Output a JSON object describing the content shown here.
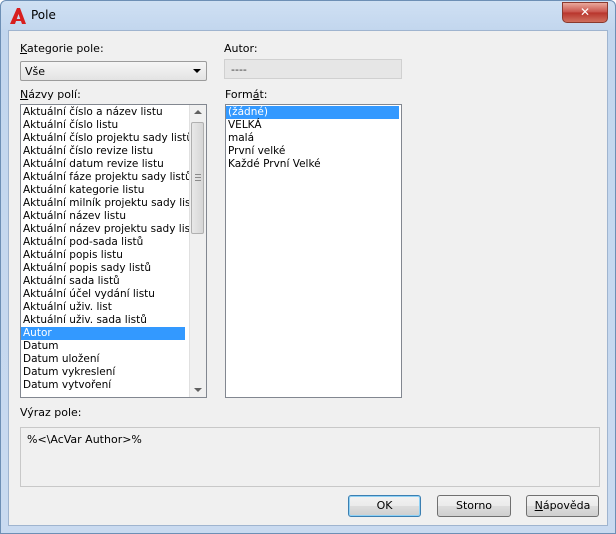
{
  "window": {
    "title": "Pole",
    "close_glyph": "✕"
  },
  "category": {
    "label": "Kategorie pole:",
    "label_accel": "K",
    "label_rest": "ategorie pole:",
    "value": "Vše"
  },
  "author": {
    "label": "Autor:",
    "value": "----"
  },
  "field_names": {
    "label_accel": "N",
    "label_rest": "ázvy polí:",
    "items": [
      "Aktuální číslo a název listu",
      "Aktuální číslo listu",
      "Aktuální číslo projektu sady listů",
      "Aktuální číslo revize listu",
      "Aktuální datum revize listu",
      "Aktuální fáze projektu sady listů",
      "Aktuální kategorie listu",
      "Aktuální milník projektu sady listů",
      "Aktuální název listu",
      "Aktuální název projektu sady listů",
      "Aktuální pod-sada listů",
      "Aktuální popis listu",
      "Aktuální popis sady listů",
      "Aktuální sada listů",
      "Aktuální účel vydání listu",
      "Aktuální uživ. list",
      "Aktuální uživ. sada listů",
      "Autor",
      "Datum",
      "Datum uložení",
      "Datum vykreslení",
      "Datum vytvoření"
    ],
    "selected_index": 17
  },
  "format": {
    "label_pre": "Form",
    "label_accel": "á",
    "label_post": "t:",
    "items": [
      "(žádné)",
      "VELKÁ",
      "malá",
      "První velké",
      "Každé První Velké"
    ],
    "selected_index": 0
  },
  "expression": {
    "label": "Výraz pole:",
    "value": "%<\\AcVar Author>%"
  },
  "buttons": {
    "ok": "OK",
    "cancel": "Storno",
    "help_accel": "N",
    "help_rest": "ápověda"
  },
  "colors": {
    "selection": "#3399ff",
    "title_bar": "#c2d6ee",
    "app_icon": "#d81e1e"
  }
}
